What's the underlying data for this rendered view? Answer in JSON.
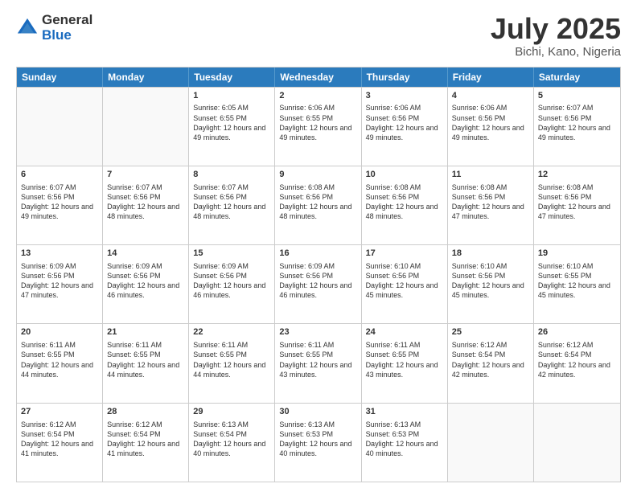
{
  "logo": {
    "general": "General",
    "blue": "Blue"
  },
  "title": {
    "month": "July 2025",
    "location": "Bichi, Kano, Nigeria"
  },
  "header_days": [
    "Sunday",
    "Monday",
    "Tuesday",
    "Wednesday",
    "Thursday",
    "Friday",
    "Saturday"
  ],
  "rows": [
    [
      {
        "day": "",
        "info": ""
      },
      {
        "day": "",
        "info": ""
      },
      {
        "day": "1",
        "info": "Sunrise: 6:05 AM\nSunset: 6:55 PM\nDaylight: 12 hours and 49 minutes."
      },
      {
        "day": "2",
        "info": "Sunrise: 6:06 AM\nSunset: 6:55 PM\nDaylight: 12 hours and 49 minutes."
      },
      {
        "day": "3",
        "info": "Sunrise: 6:06 AM\nSunset: 6:56 PM\nDaylight: 12 hours and 49 minutes."
      },
      {
        "day": "4",
        "info": "Sunrise: 6:06 AM\nSunset: 6:56 PM\nDaylight: 12 hours and 49 minutes."
      },
      {
        "day": "5",
        "info": "Sunrise: 6:07 AM\nSunset: 6:56 PM\nDaylight: 12 hours and 49 minutes."
      }
    ],
    [
      {
        "day": "6",
        "info": "Sunrise: 6:07 AM\nSunset: 6:56 PM\nDaylight: 12 hours and 49 minutes."
      },
      {
        "day": "7",
        "info": "Sunrise: 6:07 AM\nSunset: 6:56 PM\nDaylight: 12 hours and 48 minutes."
      },
      {
        "day": "8",
        "info": "Sunrise: 6:07 AM\nSunset: 6:56 PM\nDaylight: 12 hours and 48 minutes."
      },
      {
        "day": "9",
        "info": "Sunrise: 6:08 AM\nSunset: 6:56 PM\nDaylight: 12 hours and 48 minutes."
      },
      {
        "day": "10",
        "info": "Sunrise: 6:08 AM\nSunset: 6:56 PM\nDaylight: 12 hours and 48 minutes."
      },
      {
        "day": "11",
        "info": "Sunrise: 6:08 AM\nSunset: 6:56 PM\nDaylight: 12 hours and 47 minutes."
      },
      {
        "day": "12",
        "info": "Sunrise: 6:08 AM\nSunset: 6:56 PM\nDaylight: 12 hours and 47 minutes."
      }
    ],
    [
      {
        "day": "13",
        "info": "Sunrise: 6:09 AM\nSunset: 6:56 PM\nDaylight: 12 hours and 47 minutes."
      },
      {
        "day": "14",
        "info": "Sunrise: 6:09 AM\nSunset: 6:56 PM\nDaylight: 12 hours and 46 minutes."
      },
      {
        "day": "15",
        "info": "Sunrise: 6:09 AM\nSunset: 6:56 PM\nDaylight: 12 hours and 46 minutes."
      },
      {
        "day": "16",
        "info": "Sunrise: 6:09 AM\nSunset: 6:56 PM\nDaylight: 12 hours and 46 minutes."
      },
      {
        "day": "17",
        "info": "Sunrise: 6:10 AM\nSunset: 6:56 PM\nDaylight: 12 hours and 45 minutes."
      },
      {
        "day": "18",
        "info": "Sunrise: 6:10 AM\nSunset: 6:56 PM\nDaylight: 12 hours and 45 minutes."
      },
      {
        "day": "19",
        "info": "Sunrise: 6:10 AM\nSunset: 6:55 PM\nDaylight: 12 hours and 45 minutes."
      }
    ],
    [
      {
        "day": "20",
        "info": "Sunrise: 6:11 AM\nSunset: 6:55 PM\nDaylight: 12 hours and 44 minutes."
      },
      {
        "day": "21",
        "info": "Sunrise: 6:11 AM\nSunset: 6:55 PM\nDaylight: 12 hours and 44 minutes."
      },
      {
        "day": "22",
        "info": "Sunrise: 6:11 AM\nSunset: 6:55 PM\nDaylight: 12 hours and 44 minutes."
      },
      {
        "day": "23",
        "info": "Sunrise: 6:11 AM\nSunset: 6:55 PM\nDaylight: 12 hours and 43 minutes."
      },
      {
        "day": "24",
        "info": "Sunrise: 6:11 AM\nSunset: 6:55 PM\nDaylight: 12 hours and 43 minutes."
      },
      {
        "day": "25",
        "info": "Sunrise: 6:12 AM\nSunset: 6:54 PM\nDaylight: 12 hours and 42 minutes."
      },
      {
        "day": "26",
        "info": "Sunrise: 6:12 AM\nSunset: 6:54 PM\nDaylight: 12 hours and 42 minutes."
      }
    ],
    [
      {
        "day": "27",
        "info": "Sunrise: 6:12 AM\nSunset: 6:54 PM\nDaylight: 12 hours and 41 minutes."
      },
      {
        "day": "28",
        "info": "Sunrise: 6:12 AM\nSunset: 6:54 PM\nDaylight: 12 hours and 41 minutes."
      },
      {
        "day": "29",
        "info": "Sunrise: 6:13 AM\nSunset: 6:54 PM\nDaylight: 12 hours and 40 minutes."
      },
      {
        "day": "30",
        "info": "Sunrise: 6:13 AM\nSunset: 6:53 PM\nDaylight: 12 hours and 40 minutes."
      },
      {
        "day": "31",
        "info": "Sunrise: 6:13 AM\nSunset: 6:53 PM\nDaylight: 12 hours and 40 minutes."
      },
      {
        "day": "",
        "info": ""
      },
      {
        "day": "",
        "info": ""
      }
    ]
  ]
}
